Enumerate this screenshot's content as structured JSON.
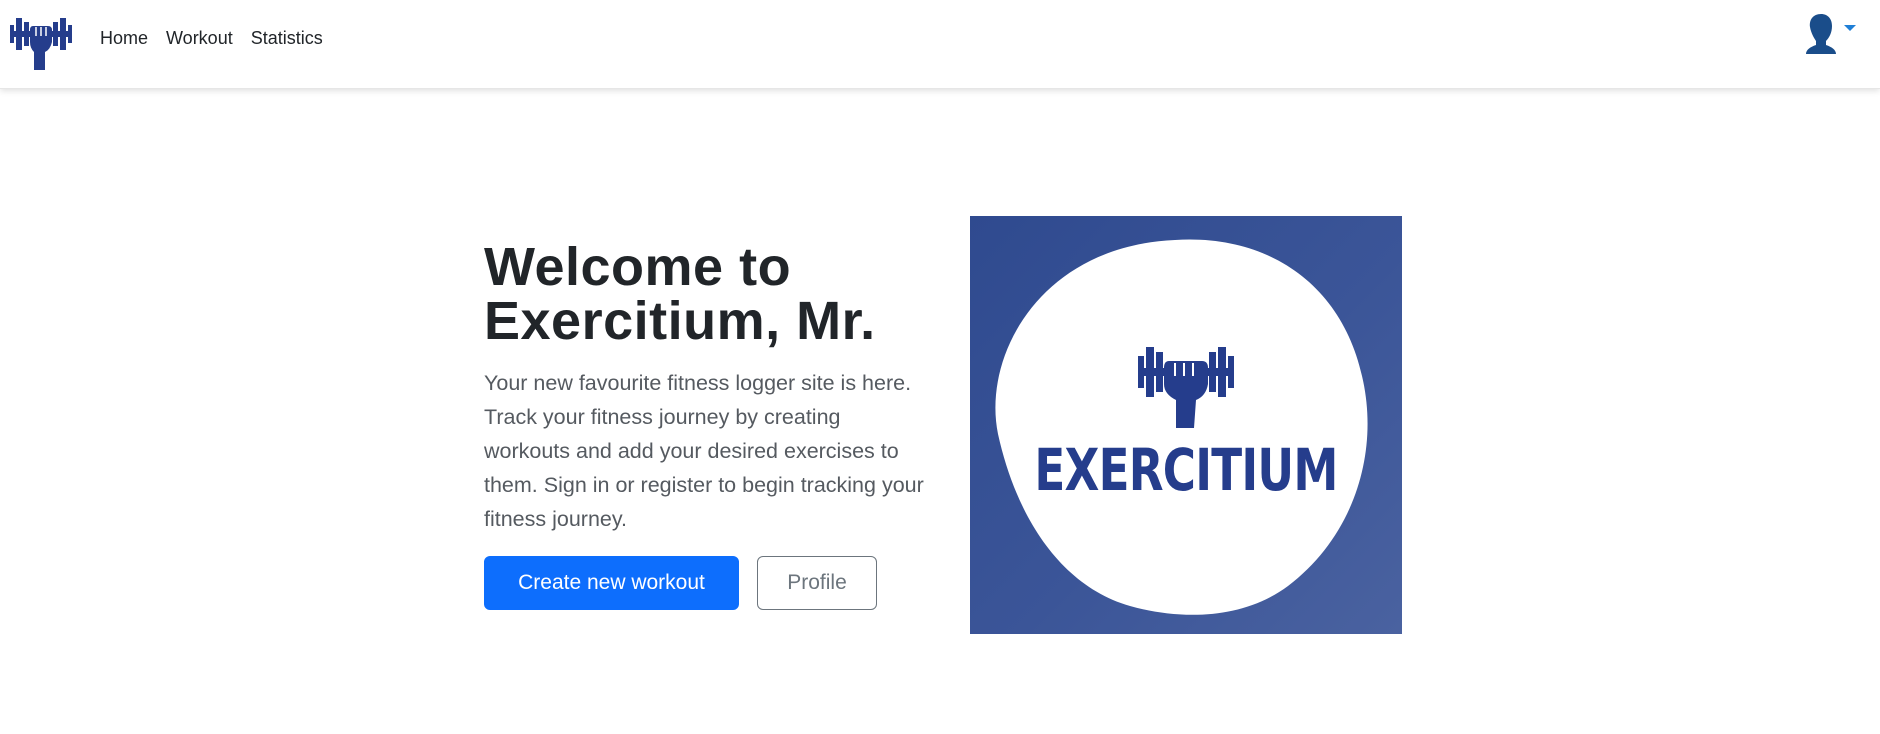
{
  "nav": {
    "links": [
      "Home",
      "Workout",
      "Statistics"
    ],
    "brand_icon": "dumbbell-fist-icon",
    "user_icon": "user-avatar-icon",
    "dropdown_icon": "caret-down-icon"
  },
  "hero": {
    "title_line1": "Welcome to",
    "title_line2": "Exercitium, Mr.",
    "description": "Your new favourite fitness logger site is here. Track your fitness journey by creating workouts and add your desired exercises to them. Sign in or register to begin tracking your fitness journey.",
    "primary_button": "Create new workout",
    "secondary_button": "Profile"
  },
  "hero_image": {
    "wordmark": "EXERCITIUM",
    "background_color": "#3b5598",
    "brand_color": "#253d8c"
  },
  "colors": {
    "primary": "#0d6efd",
    "outline": "#6c757d",
    "text": "#212529"
  }
}
